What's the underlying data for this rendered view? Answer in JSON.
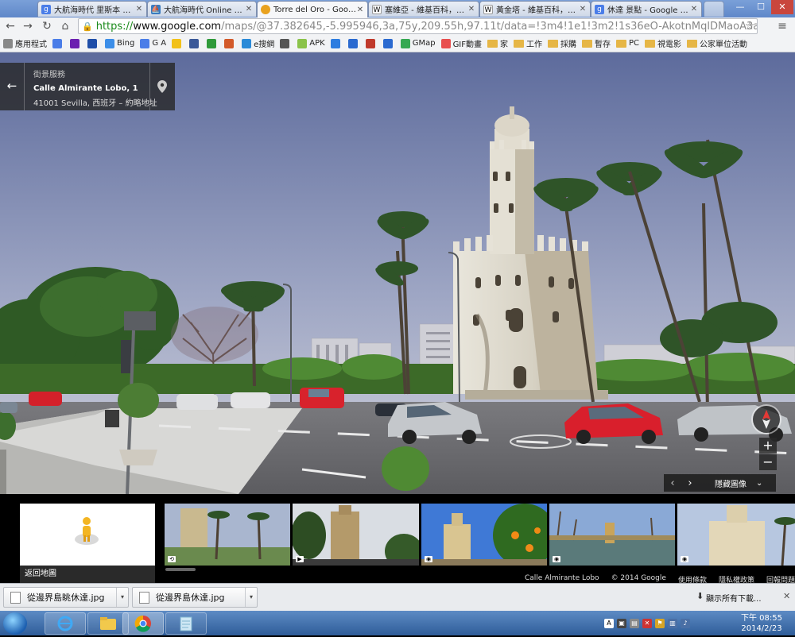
{
  "tabs": [
    {
      "title": "大航海時代 里斯本 地圖",
      "favicon": "google-g-icon"
    },
    {
      "title": "大航海時代 Online 攻略",
      "favicon": "galleon-icon"
    },
    {
      "title": "Torre del Oro - Google",
      "favicon": "street-view-icon",
      "active": true
    },
    {
      "title": "塞維亞 - 維基百科，自由",
      "favicon": "wikipedia-w-icon"
    },
    {
      "title": "黃金塔 - 維基百科，自由",
      "favicon": "wikipedia-w-icon"
    },
    {
      "title": "休達 景點 - Google 搜尋",
      "favicon": "google-g-icon"
    }
  ],
  "window_controls": {
    "minimize": "—",
    "maximize": "☐",
    "close": "✕"
  },
  "toolbar": {
    "back": "←",
    "forward": "→",
    "reload": "↻",
    "home": "⌂",
    "url_scheme": "https://",
    "url_host": "www.google.com",
    "url_rest": "/maps/@37.382645,-5.995946,3a,75y,209.55h,97.11t/data=!3m4!1e1!3m2!1s36eO-AkotnMqlDMaoA3aOw!2e0!6m1",
    "star": "☆",
    "menu": "≡"
  },
  "bookmarks": [
    {
      "label": "應用程式",
      "icon": "apps-grid-icon",
      "type": "apps"
    },
    {
      "label": "",
      "icon": "google-g-icon",
      "type": "icon"
    },
    {
      "label": "",
      "icon": "yahoo-y-icon",
      "type": "icon"
    },
    {
      "label": "",
      "icon": "paypal-p-icon",
      "type": "icon"
    },
    {
      "label": "Bing",
      "icon": "windows-logo-icon",
      "type": "icon"
    },
    {
      "label": "G A",
      "icon": "google-g-icon",
      "type": "icon"
    },
    {
      "label": "",
      "icon": "yellow-square-icon",
      "type": "icon"
    },
    {
      "label": "",
      "icon": "facebook-f-icon",
      "type": "icon"
    },
    {
      "label": "",
      "icon": "green-square-icon",
      "type": "icon"
    },
    {
      "label": "",
      "icon": "plurk-icon",
      "type": "icon"
    },
    {
      "label": "e搜網",
      "icon": "e-globe-icon",
      "type": "icon"
    },
    {
      "label": "",
      "icon": "stack-icon",
      "type": "icon"
    },
    {
      "label": "APK",
      "icon": "apk-icon",
      "type": "icon"
    },
    {
      "label": "",
      "icon": "dropbox-icon",
      "type": "icon"
    },
    {
      "label": "",
      "icon": "plus-circle-icon",
      "type": "icon"
    },
    {
      "label": "",
      "icon": "squiggle-icon",
      "type": "icon"
    },
    {
      "label": "",
      "icon": "blue-square-icon",
      "type": "icon"
    },
    {
      "label": "GMap",
      "icon": "gmap-icon",
      "type": "icon"
    },
    {
      "label": "GIF動畫",
      "icon": "gif-icon",
      "type": "icon"
    },
    {
      "label": "家",
      "icon": "folder-icon",
      "type": "folder"
    },
    {
      "label": "工作",
      "icon": "folder-icon",
      "type": "folder"
    },
    {
      "label": "採購",
      "icon": "folder-icon",
      "type": "folder"
    },
    {
      "label": "暫存",
      "icon": "folder-icon",
      "type": "folder"
    },
    {
      "label": "PC",
      "icon": "folder-icon",
      "type": "folder"
    },
    {
      "label": "視電影",
      "icon": "folder-icon",
      "type": "folder"
    },
    {
      "label": "公家單位活動",
      "icon": "folder-icon",
      "type": "folder"
    }
  ],
  "infocard": {
    "service": "街景服務",
    "street": "Calle Almirante Lobo, 1",
    "address": "41001 Sevilla, 西班牙 – 約略地址",
    "back_icon": "←"
  },
  "controls": {
    "zoom_in": "+",
    "zoom_out": "−",
    "nav_prev": "‹",
    "nav_next": "›",
    "hide_images": "隱藏圖像",
    "collapse": "⌄"
  },
  "filmstrip": {
    "map_label": "返回地圖",
    "footer": {
      "street": "Calle Almirante Lobo",
      "copyright": "© 2014 Google",
      "terms": "使用條款",
      "privacy": "隱私權政策",
      "report": "回報問題"
    }
  },
  "downloads": {
    "items": [
      "從邊界島眺休達.jpg",
      "從邊界島休達.jpg"
    ],
    "show_all": "顯示所有下載...",
    "close": "✕"
  },
  "taskbar": {
    "apps": [
      "ie-icon",
      "explorer-folder-icon",
      "chrome-icon",
      "notepad-icon"
    ],
    "time": "下午 08:55",
    "date": "2014/2/23"
  },
  "colors": {
    "sky_top": "#6d7aa8",
    "sky_bottom": "#c6c8d4",
    "road": "#6b6b70",
    "tower": "#ddd9cc",
    "car_red": "#d8202a"
  }
}
